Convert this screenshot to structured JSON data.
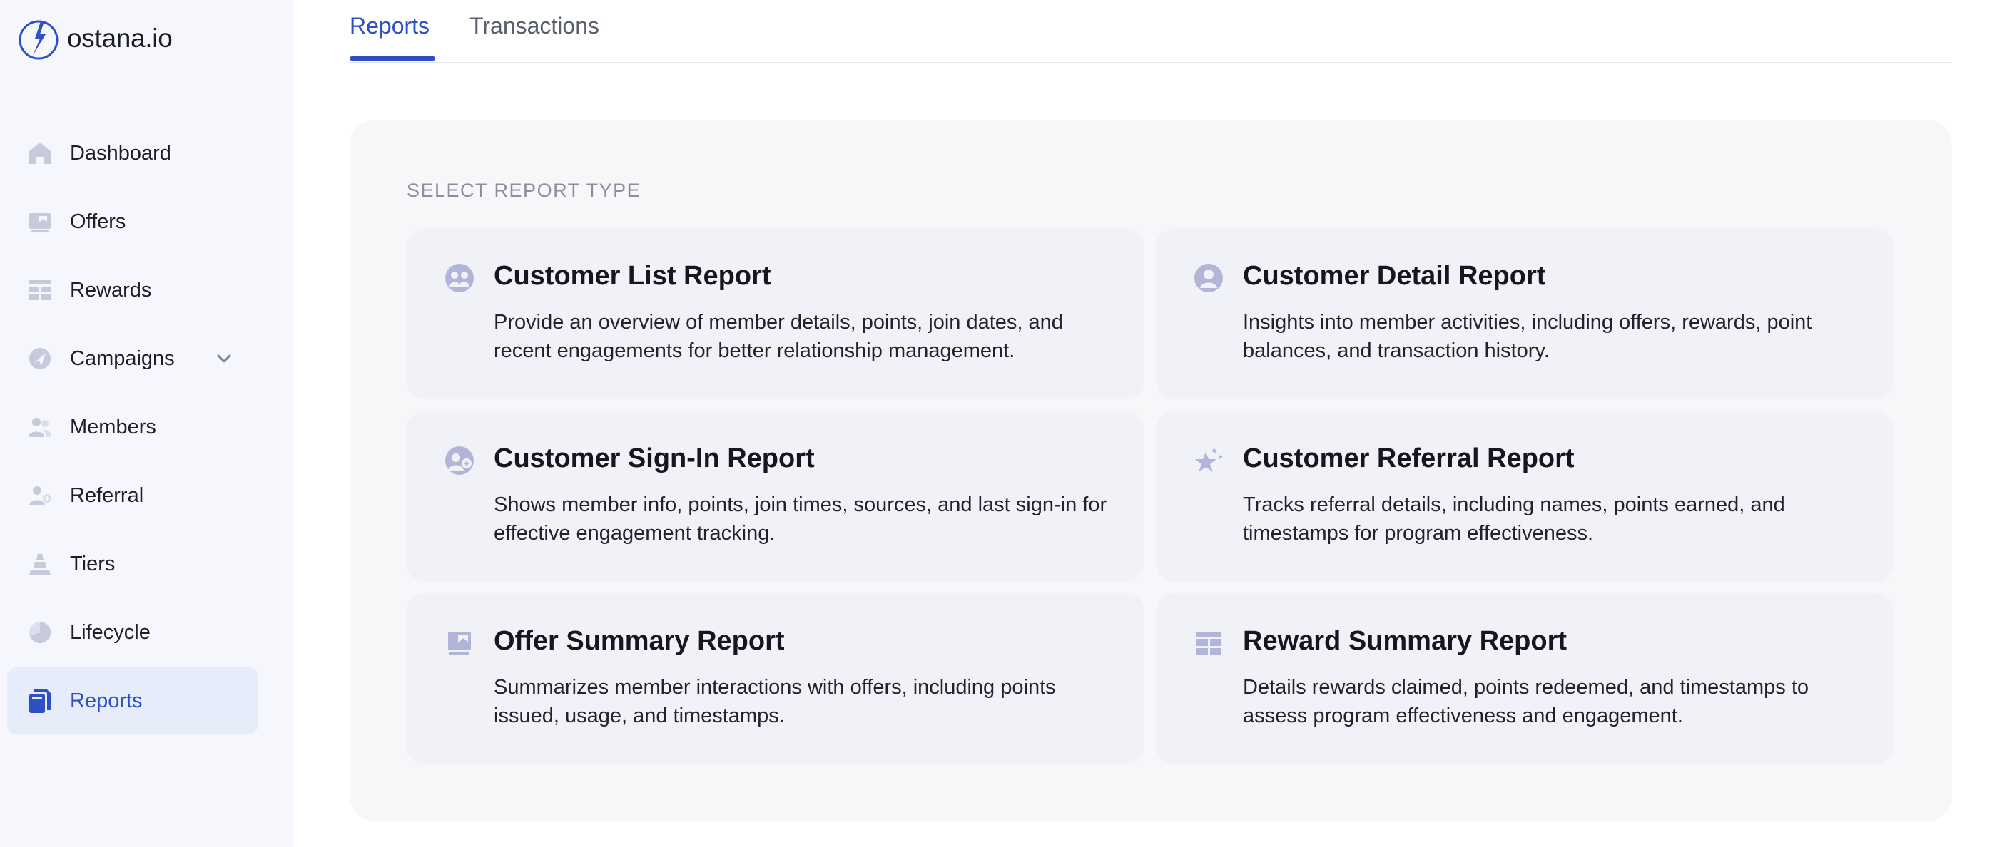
{
  "brand": {
    "name": "ostana.io"
  },
  "sidebar": {
    "items": [
      {
        "label": "Dashboard",
        "icon": "home-icon"
      },
      {
        "label": "Offers",
        "icon": "offer-icon"
      },
      {
        "label": "Rewards",
        "icon": "rewards-icon"
      },
      {
        "label": "Campaigns",
        "icon": "campaigns-icon",
        "has_submenu": true
      },
      {
        "label": "Members",
        "icon": "members-icon"
      },
      {
        "label": "Referral",
        "icon": "referral-icon"
      },
      {
        "label": "Tiers",
        "icon": "tiers-icon"
      },
      {
        "label": "Lifecycle",
        "icon": "lifecycle-icon"
      },
      {
        "label": "Reports",
        "icon": "reports-icon",
        "active": true
      }
    ]
  },
  "tabs": [
    {
      "label": "Reports",
      "active": true
    },
    {
      "label": "Transactions",
      "active": false
    }
  ],
  "main": {
    "section_label": "SELECT REPORT TYPE",
    "cards": [
      {
        "title": "Customer List Report",
        "description": "Provide an overview of member details, points, join dates, and recent engagements for better relationship management.",
        "icon": "customer-list-icon"
      },
      {
        "title": "Customer Detail Report",
        "description": "Insights into member activities, including offers, rewards, point balances, and transaction history.",
        "icon": "customer-detail-icon"
      },
      {
        "title": "Customer Sign-In Report",
        "description": "Shows member info, points, join times, sources, and last sign-in for effective engagement tracking.",
        "icon": "customer-signin-icon"
      },
      {
        "title": "Customer Referral Report",
        "description": "Tracks referral details, including names, points earned, and timestamps for program effectiveness.",
        "icon": "customer-referral-icon"
      },
      {
        "title": "Offer Summary Report",
        "description": "Summarizes member interactions with offers, including points issued, usage, and timestamps.",
        "icon": "offer-summary-icon"
      },
      {
        "title": "Reward Summary Report",
        "description": "Details rewards claimed, points redeemed, and timestamps to assess program effectiveness and engagement.",
        "icon": "reward-summary-icon"
      }
    ]
  },
  "colors": {
    "accent": "#2f4fc7",
    "sidebar_bg": "#f6f7fc",
    "active_item_bg": "#e6ecfa",
    "icon_muted": "#c7cadb",
    "card_icon": "#b3b5d8",
    "panel_bg": "#f7f7fa",
    "card_bg": "#f1f2f7"
  }
}
